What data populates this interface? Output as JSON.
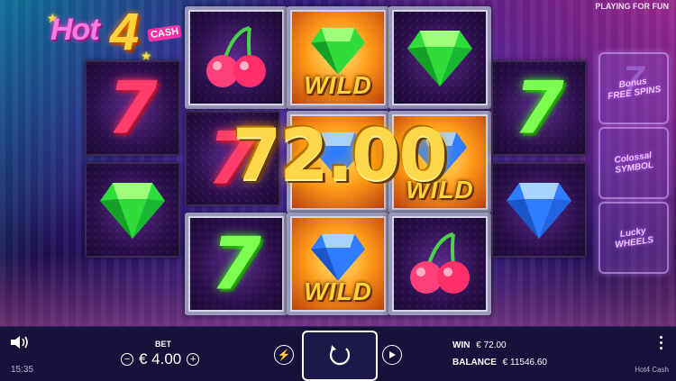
{
  "header": {
    "playing_label": "PLAYING FOR FUN"
  },
  "logo": {
    "hot": "Hot",
    "four": "4",
    "cash": "CASH"
  },
  "reels": {
    "win_amount": "72.00",
    "wild_label": "WILD",
    "cells": [
      {
        "reel": 1,
        "row": 1,
        "symbol": "red-seven",
        "glyph": "7"
      },
      {
        "reel": 1,
        "row": 2,
        "symbol": "green-gem",
        "glyph": ""
      },
      {
        "reel": 2,
        "row": 1,
        "symbol": "cherries",
        "glyph": ""
      },
      {
        "reel": 2,
        "row": 2,
        "symbol": "red-seven",
        "glyph": "7"
      },
      {
        "reel": 2,
        "row": 3,
        "symbol": "green-seven",
        "glyph": "7"
      },
      {
        "reel": 3,
        "row": 1,
        "symbol": "wild-green-gem",
        "glyph": ""
      },
      {
        "reel": 3,
        "row": 2,
        "symbol": "wild-blue-gem",
        "glyph": ""
      },
      {
        "reel": 3,
        "row": 3,
        "symbol": "wild-blue-gem",
        "glyph": ""
      },
      {
        "reel": 4,
        "row": 1,
        "symbol": "green-gem",
        "glyph": ""
      },
      {
        "reel": 4,
        "row": 2,
        "symbol": "wild-blue-gem",
        "glyph": ""
      },
      {
        "reel": 4,
        "row": 3,
        "symbol": "cherries",
        "glyph": ""
      },
      {
        "reel": 5,
        "row": 1,
        "symbol": "green-seven",
        "glyph": "7"
      },
      {
        "reel": 5,
        "row": 2,
        "symbol": "blue-gem",
        "glyph": ""
      }
    ]
  },
  "features": [
    {
      "name": "seven-free-spins",
      "line1": "Bonus",
      "line2": "FREE SPINS"
    },
    {
      "name": "colossal-symbol",
      "line1": "Colossal",
      "line2": "SYMBOL"
    },
    {
      "name": "lucky-wheels",
      "line1": "Lucky",
      "line2": "WHEELS"
    }
  ],
  "bottom_bar": {
    "time": "15:35",
    "bet_label": "BET",
    "bet_value": "€ 4.00",
    "win_label": "WIN",
    "win_value": "€ 72.00",
    "balance_label": "BALANCE",
    "balance_value": "€ 11546.60",
    "game_name": "Hot4 Cash"
  },
  "colors": {
    "accent_gold": "#ffd84a",
    "panel_bg": "#16123a",
    "neon_pink": "#ff3fcf",
    "neon_cyan": "#00e6ff"
  }
}
